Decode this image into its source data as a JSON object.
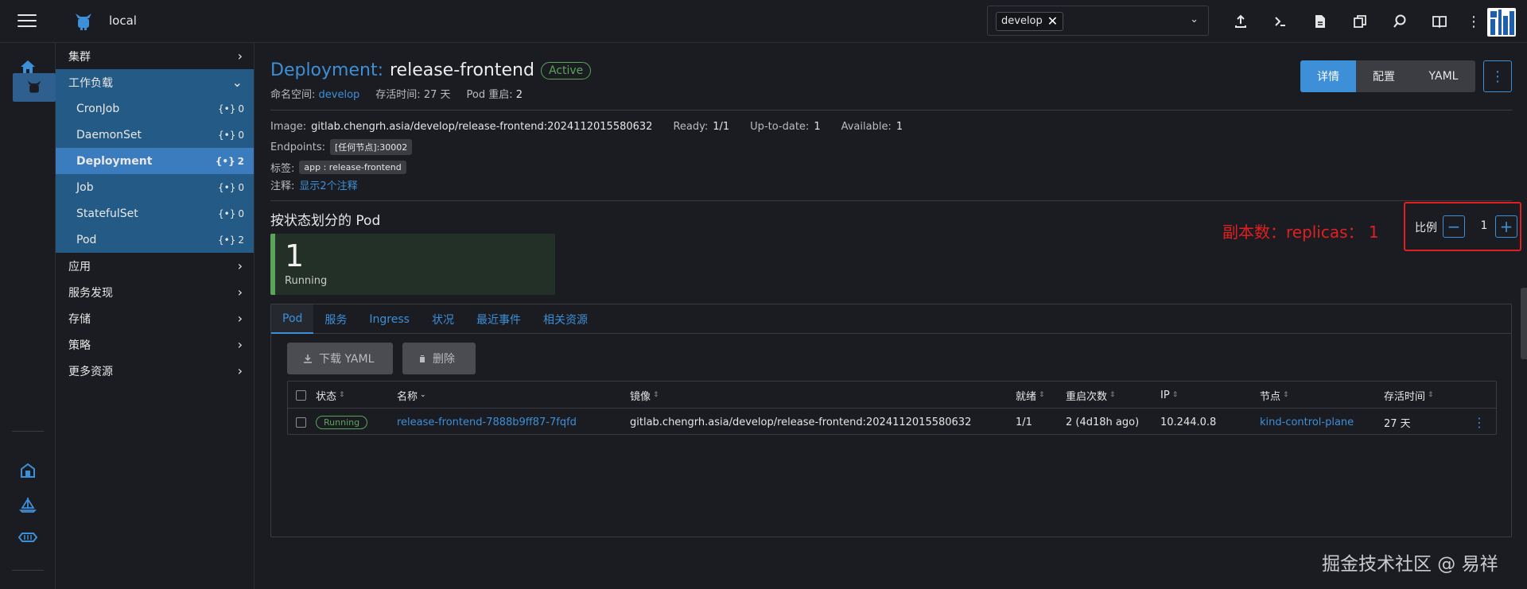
{
  "topbar": {
    "cluster_name": "local",
    "namespace_filter": "develop",
    "icons": [
      "upload-icon",
      "terminal-icon",
      "file-icon",
      "copy-icon",
      "search-icon",
      "book-icon",
      "more-vertical-icon"
    ]
  },
  "rail": {
    "icons": [
      "home-icon",
      "cluster-icon",
      "extensions-icon",
      "helm-icon",
      "fleet-icon"
    ]
  },
  "sidenav": {
    "groups": [
      {
        "label": "集群"
      },
      {
        "label": "工作负载"
      },
      {
        "label": "应用"
      },
      {
        "label": "服务发现"
      },
      {
        "label": "存储"
      },
      {
        "label": "策略"
      },
      {
        "label": "更多资源"
      }
    ],
    "workload_items": [
      {
        "label": "CronJob",
        "count": "0"
      },
      {
        "label": "DaemonSet",
        "count": "0"
      },
      {
        "label": "Deployment",
        "count": "2"
      },
      {
        "label": "Job",
        "count": "0"
      },
      {
        "label": "StatefulSet",
        "count": "0"
      },
      {
        "label": "Pod",
        "count": "2"
      }
    ]
  },
  "header": {
    "kind": "Deployment:",
    "name": "release-frontend",
    "state": "Active",
    "namespace_label": "命名空间:",
    "namespace": "develop",
    "age_label": "存活时间:",
    "age": "27 天",
    "restarts_label": "Pod 重启:",
    "restarts": "2",
    "view_tabs": [
      "详情",
      "配置",
      "YAML"
    ]
  },
  "info": {
    "image_label": "Image:",
    "image": "gitlab.chengrh.asia/develop/release-frontend:2024112015580632",
    "ready_label": "Ready:",
    "ready": "1/1",
    "uptodate_label": "Up-to-date:",
    "uptodate": "1",
    "available_label": "Available:",
    "available": "1",
    "endpoints_label": "Endpoints:",
    "endpoint_tag": "[任何节点]:30002",
    "labels_label": "标签:",
    "label_tag": "app : release-frontend",
    "annotations_label": "注释:",
    "annotations_link": "显示2个注释"
  },
  "pods_by_state": {
    "title": "按状态划分的 Pod",
    "count": "1",
    "state": "Running"
  },
  "annotation_note": "副本数：replicas： 1",
  "scale": {
    "label": "比例",
    "value": "1"
  },
  "tabs": [
    "Pod",
    "服务",
    "Ingress",
    "状况",
    "最近事件",
    "相关资源"
  ],
  "actions": {
    "download": "下载 YAML",
    "delete": "删除"
  },
  "table": {
    "headers": [
      "状态",
      "名称",
      "镜像",
      "就绪",
      "重启次数",
      "IP",
      "节点",
      "存活时间"
    ],
    "rows": [
      {
        "state": "Running",
        "name": "release-frontend-7888b9ff87-7fqfd",
        "image": "gitlab.chengrh.asia/develop/release-frontend:2024112015580632",
        "ready": "1/1",
        "restarts": "2 (4d18h ago)",
        "ip": "10.244.0.8",
        "node": "kind-control-plane",
        "age": "27 天"
      }
    ]
  },
  "watermark": "掘金技术社区 @ 易祥",
  "colors": {
    "accent": "#3d8fd8",
    "success": "#5aa55a",
    "annotation_red": "#e02020",
    "nav_active": "#245a86"
  }
}
